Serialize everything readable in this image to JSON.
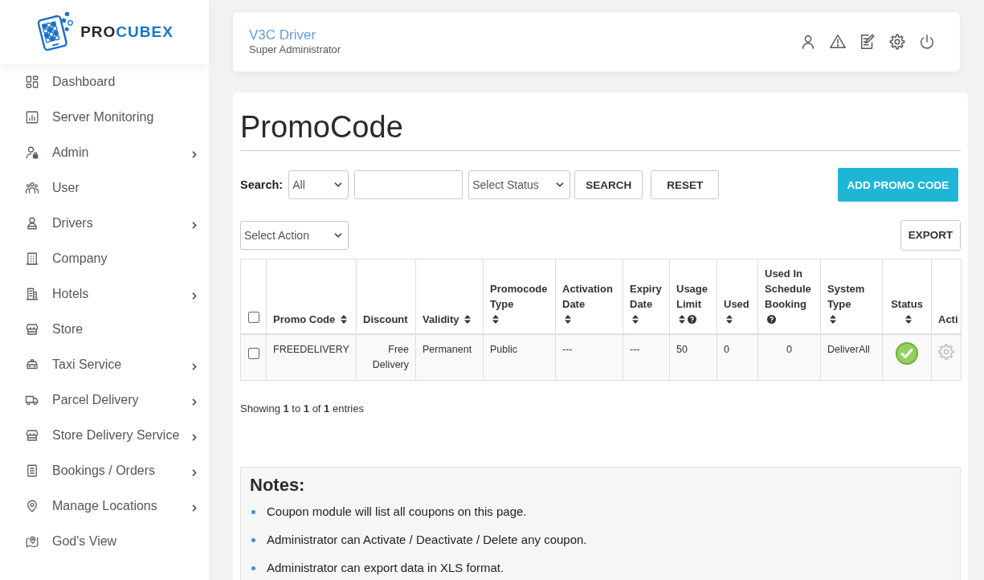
{
  "logo": {
    "text_dark": "PRO",
    "text_accent": "CUBEX"
  },
  "sidebar": {
    "items": [
      {
        "label": "Dashboard",
        "has_submenu": false
      },
      {
        "label": "Server Monitoring",
        "has_submenu": false
      },
      {
        "label": "Admin",
        "has_submenu": true
      },
      {
        "label": "User",
        "has_submenu": false
      },
      {
        "label": "Drivers",
        "has_submenu": true
      },
      {
        "label": "Company",
        "has_submenu": false
      },
      {
        "label": "Hotels",
        "has_submenu": true
      },
      {
        "label": "Store",
        "has_submenu": false
      },
      {
        "label": "Taxi Service",
        "has_submenu": true
      },
      {
        "label": "Parcel Delivery",
        "has_submenu": true
      },
      {
        "label": "Store Delivery Service",
        "has_submenu": true
      },
      {
        "label": "Bookings / Orders",
        "has_submenu": true
      },
      {
        "label": "Manage Locations",
        "has_submenu": true
      },
      {
        "label": "God's View",
        "has_submenu": false
      }
    ]
  },
  "header": {
    "user_name": "V3C Driver",
    "user_role": "Super Administrator"
  },
  "page": {
    "title": "PromoCode"
  },
  "filters": {
    "search_label": "Search:",
    "type_select": "All",
    "status_select": "Select Status",
    "search_button": "SEARCH",
    "reset_button": "RESET",
    "add_button": "ADD PROMO CODE",
    "action_select": "Select Action",
    "export_button": "EXPORT"
  },
  "table": {
    "header_checked": false,
    "columns": [
      {
        "label": "Promo Code",
        "sortable": true,
        "help": false
      },
      {
        "label": "Discount",
        "sortable": false,
        "help": false
      },
      {
        "label": "Validity",
        "sortable": true,
        "help": false
      },
      {
        "label": "Promocode Type",
        "sortable": true,
        "help": false
      },
      {
        "label": "Activation Date",
        "sortable": true,
        "help": false
      },
      {
        "label": "Expiry Date",
        "sortable": true,
        "help": false
      },
      {
        "label": "Usage Limit",
        "sortable": true,
        "help": true
      },
      {
        "label": "Used",
        "sortable": true,
        "help": false
      },
      {
        "label": "Used In Schedule Booking",
        "sortable": false,
        "help": true
      },
      {
        "label": "System Type",
        "sortable": true,
        "help": false
      },
      {
        "label": "Status",
        "sortable": true,
        "help": false
      },
      {
        "label": "Acti",
        "sortable": false,
        "help": false
      }
    ],
    "rows": [
      {
        "checked": false,
        "cells": [
          "FREEDELIVERY",
          "Free Delivery",
          "Permanent",
          "Public",
          "---",
          "---",
          "50",
          "0",
          "0",
          "DeliverAll"
        ],
        "active": true
      }
    ]
  },
  "table_info": "Showing **1** to **1** of **1** entries",
  "notes": {
    "title": "Notes:",
    "items": [
      "Coupon module will list all coupons on this page.",
      "Administrator can Activate / Deactivate / Delete any coupon.",
      "Administrator can export data in XLS format."
    ]
  }
}
